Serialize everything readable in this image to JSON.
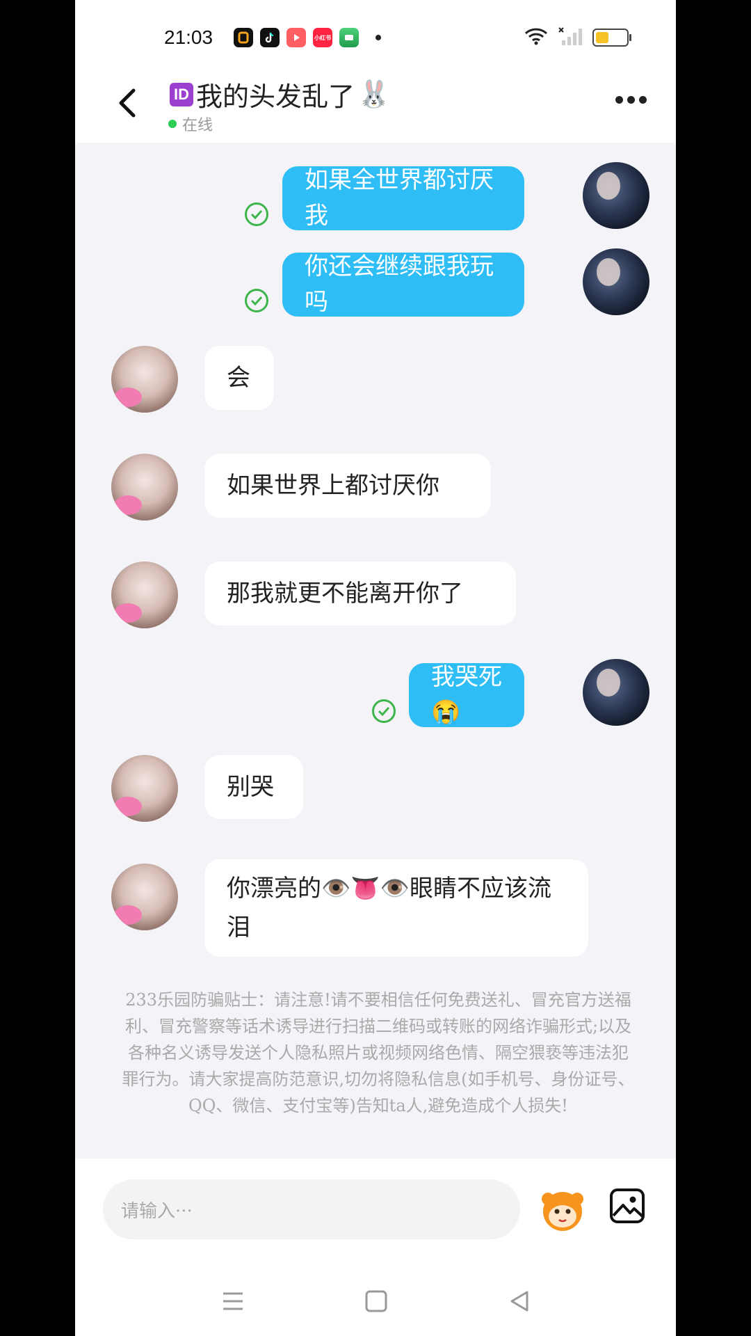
{
  "status_bar": {
    "time": "21:03",
    "apps": [
      "app-o-icon",
      "tiktok-icon",
      "video-play-icon",
      "xiaohongshu-icon",
      "game-app-icon"
    ],
    "app_labels": {
      "xiaohongshu": "小红书"
    },
    "battery_level": 0.4
  },
  "header": {
    "id_badge": "ID",
    "title": "我的头发乱了",
    "title_emoji": "🐰",
    "status": "在线"
  },
  "messages": [
    {
      "from": "me",
      "text": "如果全世界都讨厌我",
      "read": true
    },
    {
      "from": "me",
      "text": "你还会继续跟我玩吗",
      "read": true
    },
    {
      "from": "her",
      "text": "会"
    },
    {
      "from": "her",
      "text": "如果世界上都讨厌你"
    },
    {
      "from": "her",
      "text": "那我就更不能离开你了"
    },
    {
      "from": "me",
      "text": "我哭死😭",
      "read": true
    },
    {
      "from": "her",
      "text": "别哭"
    },
    {
      "from": "her",
      "text": "你漂亮的👁️👅👁️眼睛不应该流泪"
    }
  ],
  "notice": "233乐园防骗贴士：请注意!请不要相信任何免费送礼、冒充官方送福利、冒充警察等话术诱导进行扫描二维码或转账的网络诈骗形式;以及各种名义诱导发送个人隐私照片或视频网络色情、隔空猥亵等违法犯罪行为。请大家提高防范意识,切勿将隐私信息(如手机号、身份证号、QQ、微信、支付宝等)告知ta人,避免造成个人损失!",
  "input": {
    "placeholder": "请输入···"
  },
  "colors": {
    "my_bubble": "#2fbdf6",
    "her_bubble": "#ffffff",
    "background": "#f3f3f8",
    "online_dot": "#2ecc52"
  }
}
